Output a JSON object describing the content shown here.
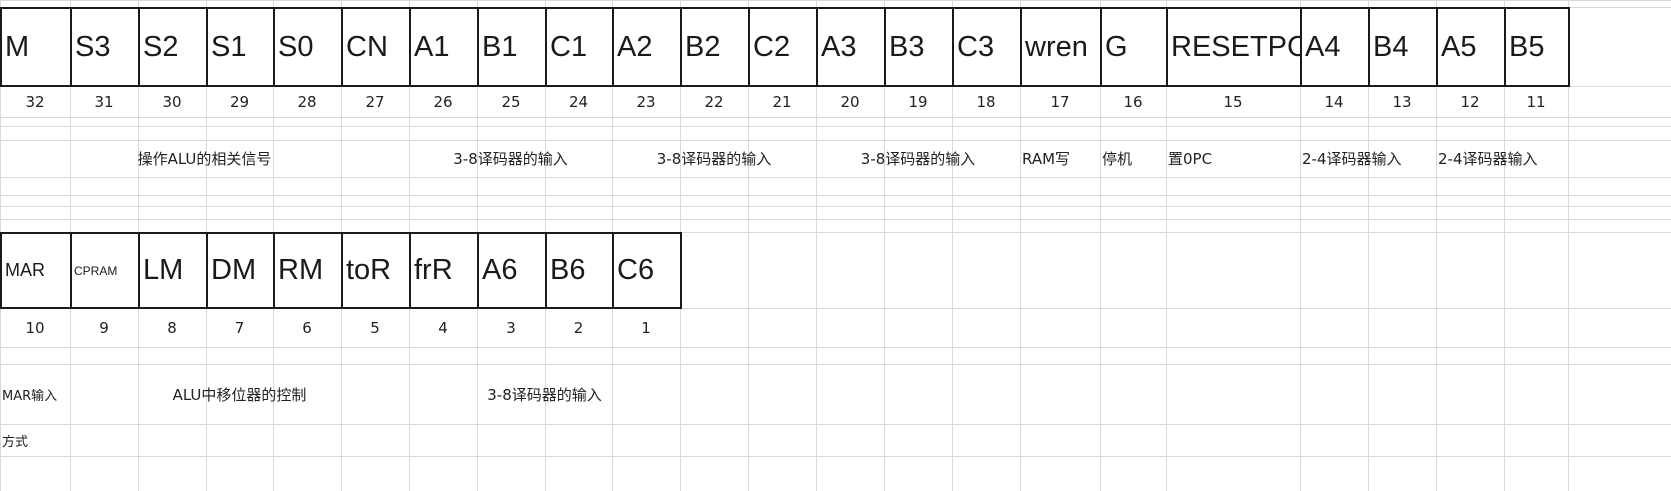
{
  "sheet": {
    "row1": {
      "headers": [
        "M",
        "S3",
        "S2",
        "S1",
        "S0",
        "CN",
        "A1",
        "B1",
        "C1",
        "A2",
        "B2",
        "C2",
        "A3",
        "B3",
        "C3",
        "wren",
        "G",
        "RESETPC",
        "A4",
        "B4",
        "A5",
        "B5"
      ],
      "bits": [
        "32",
        "31",
        "30",
        "29",
        "28",
        "27",
        "26",
        "25",
        "24",
        "23",
        "22",
        "21",
        "20",
        "19",
        "18",
        "17",
        "16",
        "15",
        "14",
        "13",
        "12",
        "11"
      ],
      "descriptions": [
        "操作ALU的相关信号",
        "3-8译码器的输入",
        "3-8译码器的输入",
        "3-8译码器的输入",
        "RAM写",
        "停机",
        "置0PC",
        "2-4译码器输入",
        "2-4译码器输入"
      ]
    },
    "row2": {
      "headers": [
        "MAR",
        "CPRAM",
        "LM",
        "DM",
        "RM",
        "toR",
        "frR",
        "A6",
        "B6",
        "C6"
      ],
      "bits": [
        "10",
        "9",
        "8",
        "7",
        "6",
        "5",
        "4",
        "3",
        "2",
        "1"
      ],
      "descriptions": [
        "MAR输入",
        "ALU中移位器的控制",
        "3-8译码器的输入"
      ],
      "desc_line2": "方式"
    }
  },
  "colors": {
    "gridline": "#d9d9d9",
    "border": "#1a1a1a",
    "background": "#ffffff"
  }
}
